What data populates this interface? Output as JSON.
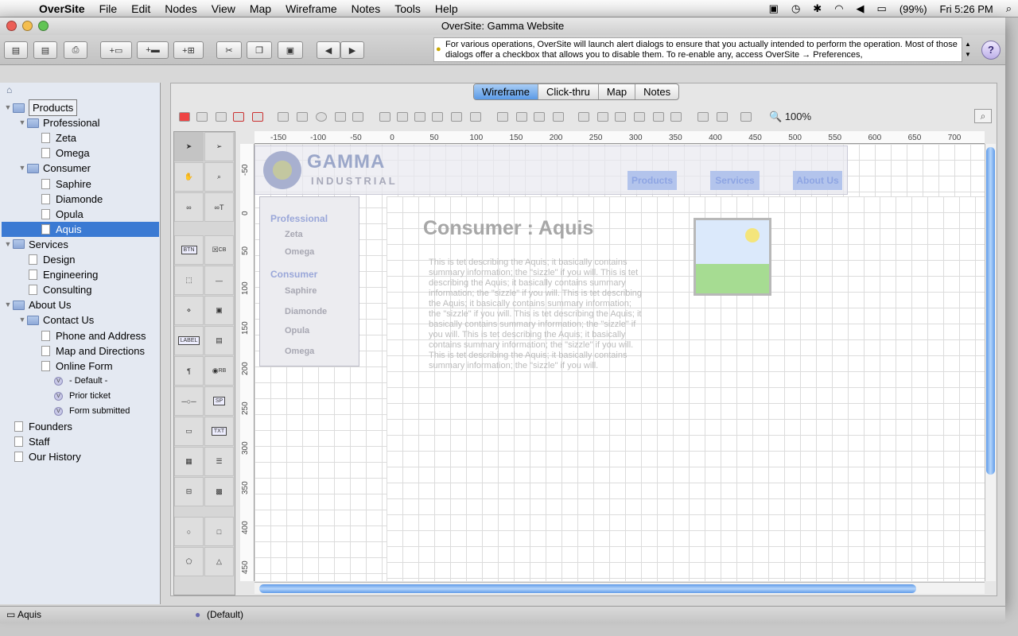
{
  "menubar": {
    "items": [
      "OverSite",
      "File",
      "Edit",
      "Nodes",
      "View",
      "Map",
      "Wireframe",
      "Notes",
      "Tools",
      "Help"
    ],
    "battery": "(99%)",
    "clock": "Fri 5:26 PM"
  },
  "window": {
    "title": "OverSite: Gamma Website",
    "tip": "For various operations, OverSite will launch alert dialogs to ensure that you actually intended to perform the operation. Most of those dialogs offer a checkbox that allows you to disable them. To re-enable any, access OverSite → Preferences,"
  },
  "tabs": [
    "Wireframe",
    "Click-thru",
    "Map",
    "Notes"
  ],
  "active_tab": "Wireframe",
  "zoom": "100%",
  "tree": [
    {
      "label": "Products",
      "type": "folder",
      "level": 0
    },
    {
      "label": "Professional",
      "type": "folder",
      "level": 1
    },
    {
      "label": "Zeta",
      "type": "page",
      "level": 2
    },
    {
      "label": "Omega",
      "type": "page",
      "level": 2
    },
    {
      "label": "Consumer",
      "type": "folder",
      "level": 1
    },
    {
      "label": "Saphire",
      "type": "page",
      "level": 2
    },
    {
      "label": "Diamonde",
      "type": "page",
      "level": 2
    },
    {
      "label": "Opula",
      "type": "page",
      "level": 2
    },
    {
      "label": "Aquis",
      "type": "page",
      "level": 2,
      "selected": true
    },
    {
      "label": "Services",
      "type": "folder",
      "level": 0
    },
    {
      "label": "Design",
      "type": "page",
      "level": 1
    },
    {
      "label": "Engineering",
      "type": "page",
      "level": 1
    },
    {
      "label": "Consulting",
      "type": "page",
      "level": 1
    },
    {
      "label": "About Us",
      "type": "folder",
      "level": 0
    },
    {
      "label": "Contact Us",
      "type": "folder",
      "level": 1
    },
    {
      "label": "Phone and Address",
      "type": "page",
      "level": 2
    },
    {
      "label": "Map and Directions",
      "type": "page",
      "level": 2
    },
    {
      "label": "Online Form",
      "type": "page",
      "level": 2
    },
    {
      "label": "- Default -",
      "type": "variant",
      "level": 3
    },
    {
      "label": "Prior ticket",
      "type": "variant",
      "level": 3
    },
    {
      "label": "Form submitted",
      "type": "variant",
      "level": 3
    },
    {
      "label": "Founders",
      "type": "page",
      "level": 0
    },
    {
      "label": "Staff",
      "type": "page",
      "level": 0
    },
    {
      "label": "Our History",
      "type": "page",
      "level": 0
    }
  ],
  "ruler": {
    "h": [
      "-150",
      "-100",
      "-50",
      "0",
      "50",
      "100",
      "150",
      "200",
      "250",
      "300",
      "350",
      "400",
      "450",
      "500",
      "550",
      "600",
      "650",
      "700"
    ],
    "v": [
      "-50",
      "0",
      "50",
      "100",
      "150",
      "200",
      "250",
      "300",
      "350",
      "400",
      "450"
    ]
  },
  "wireframe": {
    "logo_name": "GAMMA",
    "logo_sub": "INDUSTRIAL",
    "nav": [
      "Products",
      "Services",
      "About Us"
    ],
    "leftnav": {
      "professional": "Professional",
      "zeta": "Zeta",
      "omega1": "Omega",
      "consumer": "Consumer",
      "saphire": "Saphire",
      "diamonde": "Diamonde",
      "opula": "Opula",
      "omega2": "Omega"
    },
    "heading": "Consumer : Aquis",
    "paragraph": "This is tet describing the Aquis; it basically contains summary information; the \"sizzle\" if you will. This is tet describing the Aquis; it basically contains summary information; the \"sizzle\" if you will. This is tet describing the Aquis; it basically contains summary information; the \"sizzle\" if you will. This is tet describing the Aquis; it basically contains summary information; the \"sizzle\" if you will. This is tet describing the Aquis; it basically contains summary information; the \"sizzle\" if you will. This is tet describing the Aquis; it basically contains summary information; the \"sizzle\" if you will."
  },
  "palette": {
    "btn": "BTN",
    "label": "LABEL",
    "cb": "CB",
    "rb": "RB",
    "sp": "SP",
    "txt": "TXT"
  },
  "status": {
    "node": "Aquis",
    "variant": "(Default)"
  }
}
